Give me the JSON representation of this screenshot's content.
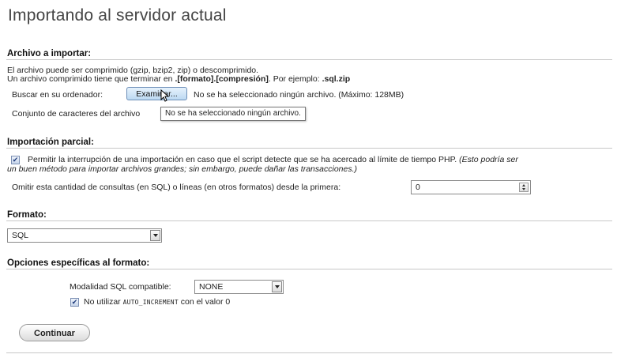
{
  "page_title": "Importando al servidor actual",
  "file_section": {
    "title": "Archivo a importar:",
    "note_line1": "El archivo puede ser comprimido (gzip, bzip2, zip) o descomprimido.",
    "note_line2_prefix": "Un archivo comprimido tiene que terminar en ",
    "note_line2_format": ".[formato].[compresión]",
    "note_line2_mid": ". Por ejemplo: ",
    "note_line2_example": ".sql.zip",
    "browse_label": "Buscar en su ordenador:",
    "browse_button": "Examinar...",
    "no_file_text": "No se ha seleccionado ningún archivo. (Máximo: 128MB)",
    "charset_label": "Conjunto de caracteres del archivo",
    "tooltip_text": "No se ha seleccionado ningún archivo."
  },
  "partial_section": {
    "title": "Importación parcial:",
    "allow_interrupt_checked": true,
    "allow_interrupt_text": "Permitir la interrupción de una importación en caso que el script detecte que se ha acercado al límite de tiempo PHP.",
    "allow_interrupt_note_a": "(Esto podría ser",
    "allow_interrupt_note_b": "un buen método para importar archivos grandes; sin embargo, puede dañar las transacciones.)",
    "skip_label": "Omitir esta cantidad de consultas (en SQL) o líneas (en otros formatos) desde la primera:",
    "skip_value": "0"
  },
  "format_section": {
    "title": "Formato:",
    "selected_format": "SQL"
  },
  "format_options_section": {
    "title": "Opciones específicas al formato:",
    "sql_mode_label": "Modalidad SQL compatible:",
    "sql_mode_value": "NONE",
    "no_auto_increment_checked": true,
    "no_auto_increment_prefix": "No utilizar",
    "no_auto_increment_code": "AUTO_INCREMENT",
    "no_auto_increment_suffix": "con el valor 0"
  },
  "submit_label": "Continuar"
}
